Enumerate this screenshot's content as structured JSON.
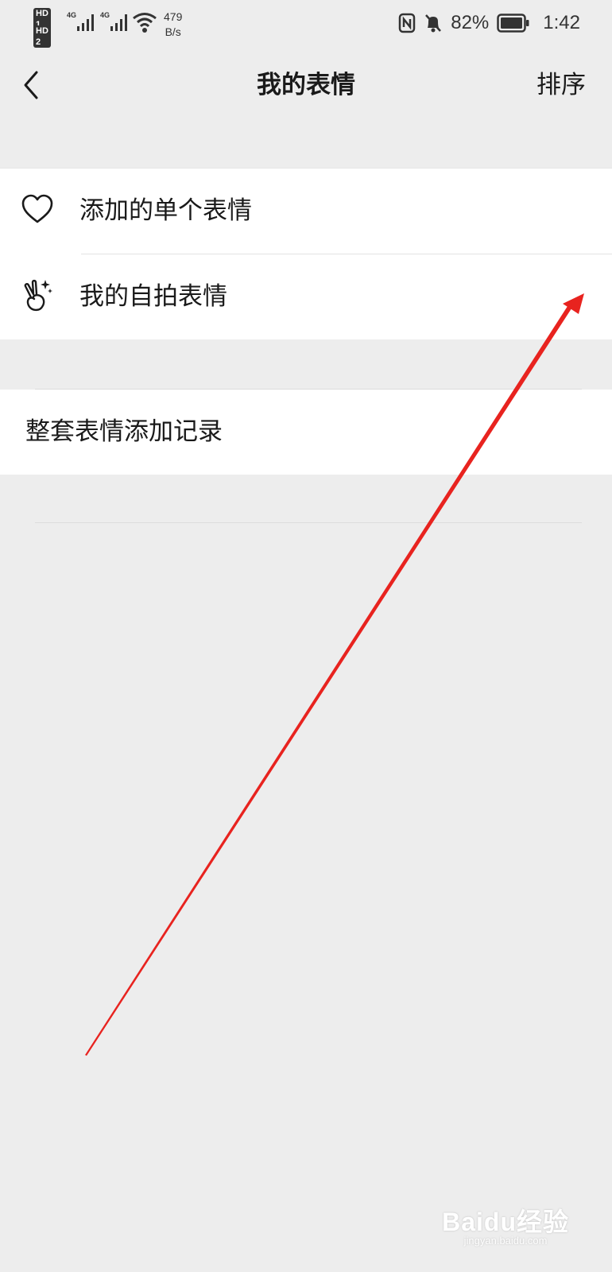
{
  "status_bar": {
    "sim1": "HD 1",
    "sim2": "HD 2",
    "net1": "4G",
    "net2": "4G",
    "speed_value": "479",
    "speed_unit": "B/s",
    "battery_percent": "82%",
    "time": "1:42",
    "icons": [
      "signal-icon",
      "wifi-icon",
      "nfc-icon",
      "mute-bell-icon",
      "battery-icon"
    ]
  },
  "nav": {
    "title": "我的表情",
    "sort_label": "排序",
    "back_icon": "back-chevron-icon"
  },
  "list": {
    "items": [
      {
        "label": "添加的单个表情",
        "icon": "heart-icon"
      },
      {
        "label": "我的自拍表情",
        "icon": "selfie-hand-icon"
      }
    ]
  },
  "records": {
    "label": "整套表情添加记录"
  },
  "annotation": {
    "arrow_color": "#e8231f"
  },
  "watermark": {
    "logo": "Baidu经验",
    "url": "jingyan.baidu.com"
  }
}
